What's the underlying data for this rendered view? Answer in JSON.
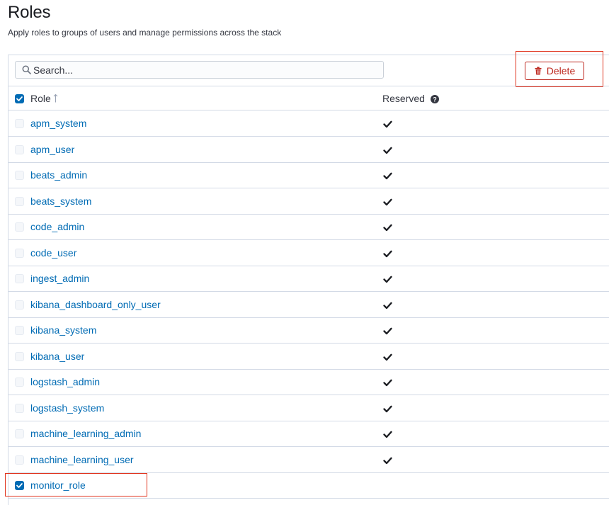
{
  "page": {
    "title": "Roles",
    "subtitle": "Apply roles to groups of users and manage permissions across the stack"
  },
  "toolbar": {
    "search_placeholder": "Search...",
    "search_value": "",
    "delete_label": "Delete"
  },
  "table": {
    "columns": {
      "role": "Role",
      "reserved": "Reserved"
    },
    "select_all_checked": true,
    "sort": {
      "column": "Role",
      "direction": "ascending"
    },
    "rows": [
      {
        "name": "apm_system",
        "selected": false,
        "reserved": true
      },
      {
        "name": "apm_user",
        "selected": false,
        "reserved": true
      },
      {
        "name": "beats_admin",
        "selected": false,
        "reserved": true
      },
      {
        "name": "beats_system",
        "selected": false,
        "reserved": true
      },
      {
        "name": "code_admin",
        "selected": false,
        "reserved": true
      },
      {
        "name": "code_user",
        "selected": false,
        "reserved": true
      },
      {
        "name": "ingest_admin",
        "selected": false,
        "reserved": true
      },
      {
        "name": "kibana_dashboard_only_user",
        "selected": false,
        "reserved": true
      },
      {
        "name": "kibana_system",
        "selected": false,
        "reserved": true
      },
      {
        "name": "kibana_user",
        "selected": false,
        "reserved": true
      },
      {
        "name": "logstash_admin",
        "selected": false,
        "reserved": true
      },
      {
        "name": "logstash_system",
        "selected": false,
        "reserved": true
      },
      {
        "name": "machine_learning_admin",
        "selected": false,
        "reserved": true
      },
      {
        "name": "machine_learning_user",
        "selected": false,
        "reserved": true
      },
      {
        "name": "monitor_role",
        "selected": true,
        "reserved": false
      }
    ]
  },
  "icons": {
    "search": "search-icon",
    "delete": "trash-icon",
    "sort": "sort-ascending-icon",
    "help": "question-circle-icon",
    "reserved": "check-icon"
  },
  "colors": {
    "link": "#006bb4",
    "danger": "#bd271e",
    "highlight": "#e0351f",
    "border": "#d3dae6"
  }
}
